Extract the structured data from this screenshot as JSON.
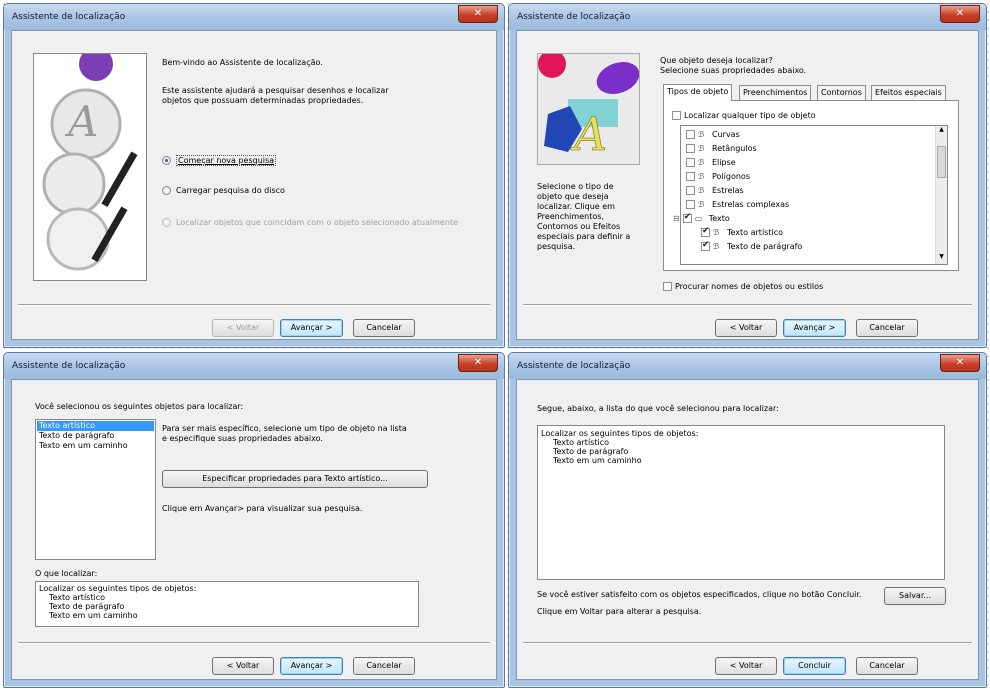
{
  "windows": {
    "w1": {
      "title": "Assistente de localização",
      "welcome": "Bem-vindo ao Assistente de localização.",
      "description": "Este assistente ajudará a pesquisar desenhos e localizar objetos que possuam determinadas propriedades.",
      "options": [
        "Começar nova pesquisa",
        "Carregar pesquisa do disco",
        "Localizar objetos que coincidam com o objeto selecionado atualmente"
      ],
      "back": "< Voltar",
      "next": "Avançar >",
      "cancel": "Cancelar"
    },
    "w2": {
      "title": "Assistente de localização",
      "question1": "Que objeto deseja localizar?",
      "question2": "Selecione suas propriedades abaixo.",
      "tabs": [
        "Tipos de objeto",
        "Preenchimentos",
        "Contornos",
        "Efeitos especiais"
      ],
      "any_type": "Localizar qualquer tipo de objeto",
      "tree": [
        "Curvas",
        "Retângulos",
        "Elipse",
        "Polígonos",
        "Estrelas",
        "Estrelas complexas",
        "Texto",
        "Texto artístico",
        "Texto de parágrafo"
      ],
      "side_help": "Selecione o tipo de objeto que deseja localizar. Clique em Preenchimentos, Contornos ou Efeitos especiais para definir a pesquisa.",
      "search_names": "Procurar nomes de objetos ou estilos",
      "back": "< Voltar",
      "next": "Avançar >",
      "cancel": "Cancelar"
    },
    "w3": {
      "title": "Assistente de localização",
      "heading": "Você selecionou os seguintes objetos para localizar:",
      "list": [
        "Texto artístico",
        "Texto de parágrafo",
        "Texto em um caminho"
      ],
      "help": "Para ser mais específico, selecione um tipo de objeto na lista e especifique suas propriedades abaixo.",
      "specify": "Especificar propriedades para Texto artístico...",
      "hint": "Clique em Avançar> para visualizar sua pesquisa.",
      "what_label": "O que localizar:",
      "summary": [
        "Localizar os seguintes tipos de objetos:",
        "Texto artístico",
        "Texto de parágrafo",
        "Texto em um caminho"
      ],
      "back": "< Voltar",
      "next": "Avançar >",
      "cancel": "Cancelar"
    },
    "w4": {
      "title": "Assistente de localização",
      "heading": "Segue, abaixo, a lista do que você selecionou para localizar:",
      "summary": [
        "Localizar os seguintes tipos de objetos:",
        "Texto artístico",
        "Texto de parágrafo",
        "Texto em um caminho"
      ],
      "satisfied": "Se você estiver satisfeito com os objetos especificados, clique no botão Concluir.",
      "save": "Salvar...",
      "alter": "Clique em Voltar para alterar a pesquisa.",
      "back": "< Voltar",
      "finish": "Concluir",
      "cancel": "Cancelar"
    }
  }
}
